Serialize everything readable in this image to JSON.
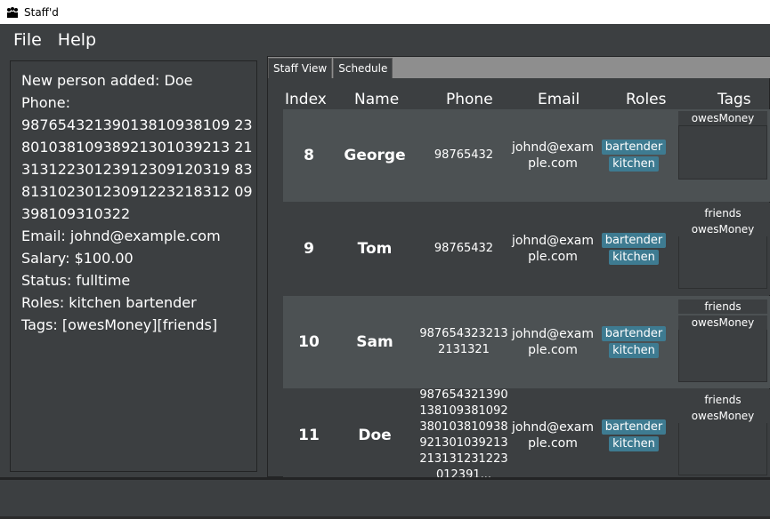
{
  "app": {
    "title": "Staff'd"
  },
  "menu": {
    "file": "File",
    "help": "Help"
  },
  "result": {
    "lines": [
      "New person added: Doe",
      "Phone:",
      "98765432139013810938109 23",
      "80103810938921301039213 21",
      "31312230123912309120319 83",
      "81310230123091223218312 09",
      "398109310322",
      "Email: johnd@example.com",
      "Salary: $100.00",
      "Status: fulltime",
      "Roles: kitchen bartender",
      "Tags: [owesMoney][friends]"
    ]
  },
  "tabs": [
    "Staff View",
    "Schedule"
  ],
  "table": {
    "headers": {
      "index": "Index",
      "name": "Name",
      "phone": "Phone",
      "email": "Email",
      "roles": "Roles",
      "tags": "Tags"
    },
    "rows": [
      {
        "index": "8",
        "name": "George",
        "phone": "98765432",
        "email": "johnd@example.com",
        "roles": [
          "bartender",
          "kitchen"
        ],
        "tags": [
          "owesMoney"
        ]
      },
      {
        "index": "9",
        "name": "Tom",
        "phone": "98765432",
        "email": "johnd@example.com",
        "roles": [
          "bartender",
          "kitchen"
        ],
        "tags": [
          "friends",
          "owesMoney"
        ]
      },
      {
        "index": "10",
        "name": "Sam",
        "phone": "9876543232132131321",
        "email": "johnd@example.com",
        "roles": [
          "bartender",
          "kitchen"
        ],
        "tags": [
          "friends",
          "owesMoney"
        ]
      },
      {
        "index": "11",
        "name": "Doe",
        "phone": "987654321390138109381092380103810938921301039213213131231223012391...",
        "email": "johnd@example.com",
        "roles": [
          "bartender",
          "kitchen"
        ],
        "tags": [
          "friends",
          "owesMoney"
        ]
      }
    ]
  }
}
